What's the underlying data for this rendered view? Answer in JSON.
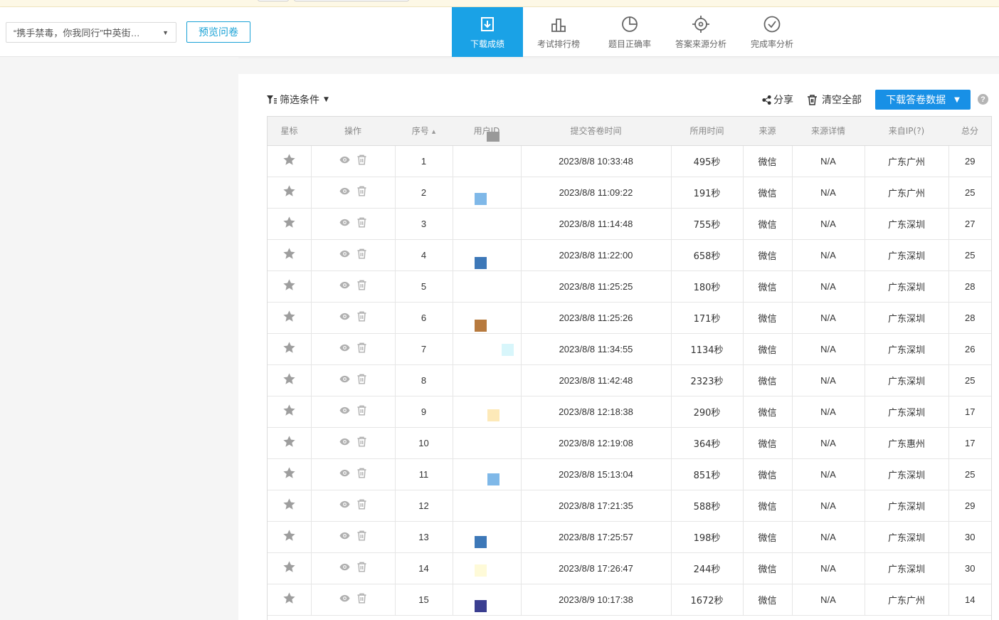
{
  "header": {
    "survey_select": "“携手禁毒，你我同行”中英街…",
    "preview_label": "预览问卷",
    "nav": [
      {
        "label": "下载成绩",
        "icon": "download-icon",
        "active": true
      },
      {
        "label": "考试排行榜",
        "icon": "ranking-icon",
        "active": false
      },
      {
        "label": "题目正确率",
        "icon": "pie-chart-icon",
        "active": false
      },
      {
        "label": "答案来源分析",
        "icon": "target-icon",
        "active": false
      },
      {
        "label": "完成率分析",
        "icon": "check-circle-icon",
        "active": false
      }
    ]
  },
  "toolbar": {
    "filter_label": "筛选条件",
    "share_label": "分享",
    "clear_label": "清空全部",
    "download_label": "下载答卷数据",
    "help_label": "?"
  },
  "table": {
    "columns": [
      "星标",
      "操作",
      "序号",
      "用户ID",
      "提交答卷时间",
      "所用时间",
      "来源",
      "来源详情",
      "来自IP(?)",
      "总分"
    ],
    "rows": [
      {
        "seq": "1",
        "time": "2023/8/8 10:33:48",
        "duration": "495秒",
        "source": "微信",
        "detail": "N/A",
        "ip": "广东广州",
        "score": "29"
      },
      {
        "seq": "2",
        "time": "2023/8/8 11:09:22",
        "duration": "191秒",
        "source": "微信",
        "detail": "N/A",
        "ip": "广东广州",
        "score": "25"
      },
      {
        "seq": "3",
        "time": "2023/8/8 11:14:48",
        "duration": "755秒",
        "source": "微信",
        "detail": "N/A",
        "ip": "广东深圳",
        "score": "27"
      },
      {
        "seq": "4",
        "time": "2023/8/8 11:22:00",
        "duration": "658秒",
        "source": "微信",
        "detail": "N/A",
        "ip": "广东深圳",
        "score": "25"
      },
      {
        "seq": "5",
        "time": "2023/8/8 11:25:25",
        "duration": "180秒",
        "source": "微信",
        "detail": "N/A",
        "ip": "广东深圳",
        "score": "28"
      },
      {
        "seq": "6",
        "time": "2023/8/8 11:25:26",
        "duration": "171秒",
        "source": "微信",
        "detail": "N/A",
        "ip": "广东深圳",
        "score": "28"
      },
      {
        "seq": "7",
        "time": "2023/8/8 11:34:55",
        "duration": "1134秒",
        "source": "微信",
        "detail": "N/A",
        "ip": "广东深圳",
        "score": "26"
      },
      {
        "seq": "8",
        "time": "2023/8/8 11:42:48",
        "duration": "2323秒",
        "source": "微信",
        "detail": "N/A",
        "ip": "广东深圳",
        "score": "25"
      },
      {
        "seq": "9",
        "time": "2023/8/8 12:18:38",
        "duration": "290秒",
        "source": "微信",
        "detail": "N/A",
        "ip": "广东深圳",
        "score": "17"
      },
      {
        "seq": "10",
        "time": "2023/8/8 12:19:08",
        "duration": "364秒",
        "source": "微信",
        "detail": "N/A",
        "ip": "广东惠州",
        "score": "17"
      },
      {
        "seq": "11",
        "time": "2023/8/8 15:13:04",
        "duration": "851秒",
        "source": "微信",
        "detail": "N/A",
        "ip": "广东深圳",
        "score": "25"
      },
      {
        "seq": "12",
        "time": "2023/8/8 17:21:35",
        "duration": "588秒",
        "source": "微信",
        "detail": "N/A",
        "ip": "广东深圳",
        "score": "29"
      },
      {
        "seq": "13",
        "time": "2023/8/8 17:25:57",
        "duration": "198秒",
        "source": "微信",
        "detail": "N/A",
        "ip": "广东深圳",
        "score": "30"
      },
      {
        "seq": "14",
        "time": "2023/8/8 17:26:47",
        "duration": "244秒",
        "source": "微信",
        "detail": "N/A",
        "ip": "广东深圳",
        "score": "30"
      },
      {
        "seq": "15",
        "time": "2023/8/9 10:17:38",
        "duration": "1672秒",
        "source": "微信",
        "detail": "N/A",
        "ip": "广东广州",
        "score": "14"
      }
    ]
  },
  "colors": {
    "accent": "#1aa2e6",
    "download_button": "#1890e6",
    "preview_border": "#1aa2d6"
  }
}
